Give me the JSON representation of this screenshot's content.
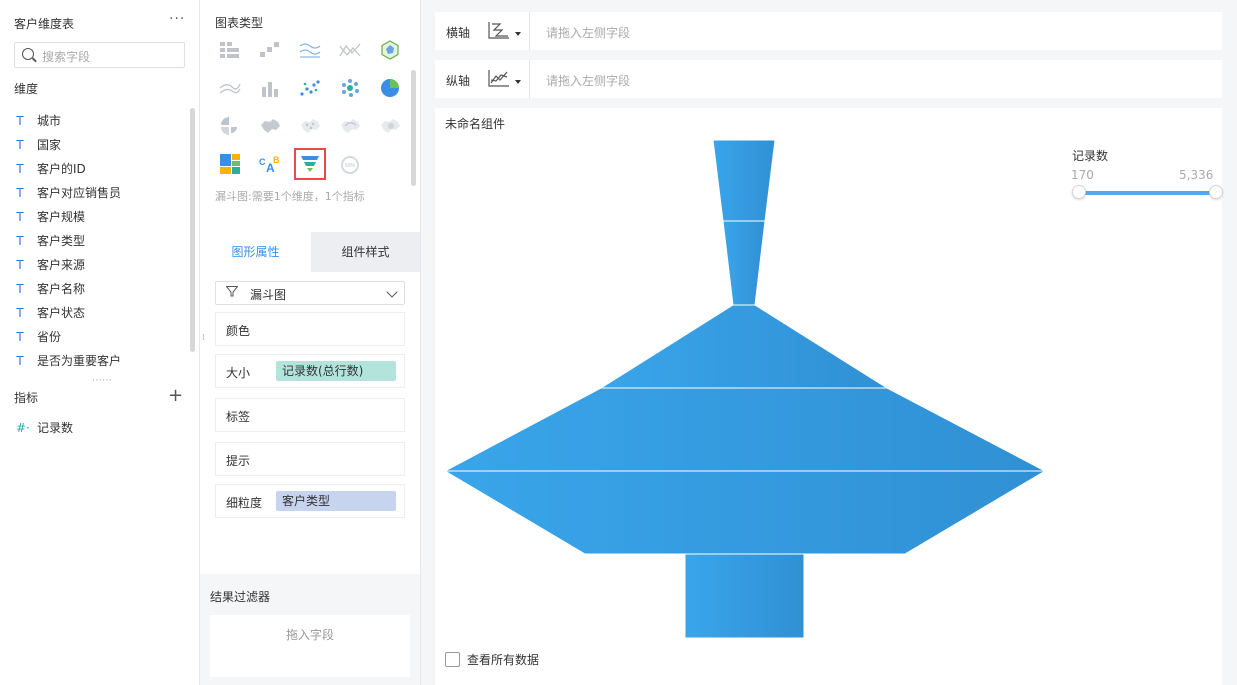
{
  "left": {
    "title": "客户维度表",
    "more": "···",
    "search_placeholder": "搜索字段",
    "dimension_label": "维度",
    "dimensions": [
      {
        "type": "T",
        "label": "城市"
      },
      {
        "type": "T",
        "label": "国家"
      },
      {
        "type": "T",
        "label": "客户的ID"
      },
      {
        "type": "T",
        "label": "客户对应销售员"
      },
      {
        "type": "T",
        "label": "客户规模"
      },
      {
        "type": "T",
        "label": "客户类型"
      },
      {
        "type": "T",
        "label": "客户来源"
      },
      {
        "type": "T",
        "label": "客户名称"
      },
      {
        "type": "T",
        "label": "客户状态"
      },
      {
        "type": "T",
        "label": "省份"
      },
      {
        "type": "T",
        "label": "是否为重要客户"
      }
    ],
    "metric_label": "指标",
    "add": "+",
    "metrics": [
      {
        "type": "#·",
        "label": "记录数"
      }
    ]
  },
  "middle": {
    "chart_type_title": "图表类型",
    "chart_types": [
      "table-icon",
      "cross-table-icon",
      "multi-line-icon",
      "radar-line-icon",
      "hex-map-icon",
      "area-icon",
      "bar-chart-icon",
      "scatter-icon",
      "bubble-icon",
      "pie-chart-icon",
      "rose-chart-icon",
      "region-map-icon",
      "point-map-icon",
      "flow-map-icon",
      "heat-map-icon",
      "treemap-icon",
      "word-cloud-icon",
      "funnel-icon",
      "gauge-icon"
    ],
    "selected_chart": "funnel-icon",
    "gauge_text": "50%",
    "word_cloud_text": "CAB",
    "chart_desc": "漏斗图:需要1个维度，1个指标",
    "tab_active": "图形属性",
    "tab_inactive": "组件样式",
    "type_select": "漏斗图",
    "props": {
      "color": "颜色",
      "size": "大小",
      "size_field": "记录数(总行数)",
      "label": "标签",
      "tooltip": "提示",
      "granularity": "细粒度",
      "granularity_field": "客户类型"
    },
    "filter_title": "结果过滤器",
    "filter_placeholder": "拖入字段"
  },
  "right": {
    "x_axis_label": "横轴",
    "y_axis_label": "纵轴",
    "axis_placeholder": "请拖入左侧字段",
    "component_title": "未命名组件",
    "legend_title": "记录数",
    "legend_min": "170",
    "legend_max": "5,336",
    "view_all": "查看所有数据",
    "funnel_color": "#3aa1e6"
  }
}
